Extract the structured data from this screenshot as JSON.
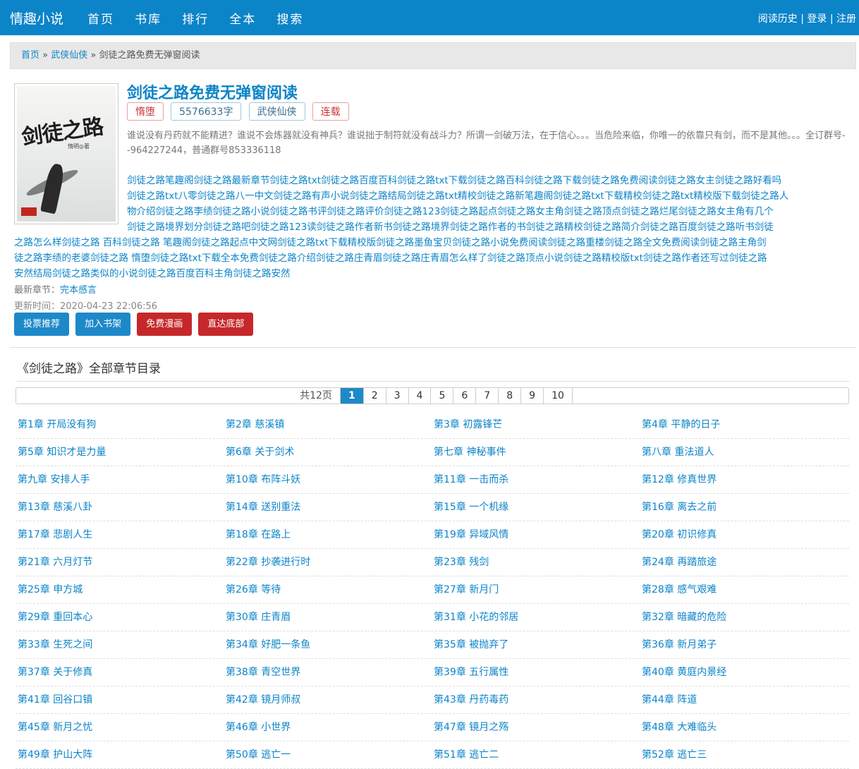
{
  "header": {
    "logo": "情趣小说",
    "nav": [
      "首页",
      "书库",
      "排行",
      "全本",
      "搜索"
    ],
    "history": "阅读历史",
    "login": "登录",
    "register": "注册",
    "sep": "|"
  },
  "breadcrumb": {
    "home": "首页",
    "category": "武侠仙侠",
    "current": "剑徒之路免费无弹窗阅读",
    "sep": "»"
  },
  "book": {
    "cover_title": "剑徒之路",
    "cover_author": "惰明◎著",
    "title": "剑徒之路免费无弹窗阅读",
    "author": "惰堕",
    "words": "5576633字",
    "category": "武侠仙侠",
    "status": "连载",
    "intro": "谁说没有丹药就不能精进？谁说不会炼器就没有神兵？谁说拙于制符就没有战斗力？所谓一剑破万法，在于信心。。。当危险来临，你唯一的依靠只有剑，而不是其他。。。全订群号--964227244，普通群号853336118",
    "keywords": [
      "剑徒之路笔趣阁剑徒之路最新章节剑徒之路txt剑徒之路百度百科剑徒之路txt下载剑徒之路百科剑徒之路下载剑徒之路免费阅读剑徒之路女主剑徒之路好看吗",
      "剑徒之路txt八零剑徒之路八一中文剑徒之路有声小说剑徒之路结局剑徒之路txt精校剑徒之路新笔趣阁剑徒之路txt下载精校剑徒之路txt精校版下载剑徒之路人",
      "物介绍剑徒之路李绩剑徒之路小说剑徒之路书评剑徒之路评价剑徒之路123剑徒之路起点剑徒之路女主角剑徒之路顶点剑徒之路烂尾剑徒之路女主角有几个",
      "剑徒之路境界划分剑徒之路吧剑徒之路123读剑徒之路作者新书剑徒之路境界剑徒之路作者的书剑徒之路精校剑徒之路简介剑徒之路百度剑徒之路听书剑徒",
      "之路怎么样剑徒之路 百科剑徒之路 笔趣阁剑徒之路起点中文网剑徒之路txt下载精校版剑徒之路墨鱼宝贝剑徒之路小说免费阅读剑徒之路重楼剑徒之路全文免费阅读剑徒之路主角剑",
      "徒之路李绩的老婆剑徒之路 惰堕剑徒之路txt下载全本免费剑徒之路介绍剑徒之路庄青眉剑徒之路庄青眉怎么样了剑徒之路顶点小说剑徒之路精校版txt剑徒之路作者还写过剑徒之路",
      "安然结局剑徒之路类似的小说剑徒之路百度百科主角剑徒之路安然"
    ],
    "latest_label": "最新章节：",
    "latest_chapter": "完本感言",
    "updated": "更新时间：2020-04-23 22:06:56"
  },
  "actions": [
    "投票推荐",
    "加入书架",
    "免费漫画",
    "直达底部"
  ],
  "catalog": {
    "title": "《剑徒之路》全部章节目录",
    "pager_total": "共12页",
    "pages": [
      "1",
      "2",
      "3",
      "4",
      "5",
      "6",
      "7",
      "8",
      "9",
      "10"
    ],
    "current_page": "1"
  },
  "chapters": [
    "第1章 开局没有狗",
    "第2章 慈溪镇",
    "第3章 初露锋芒",
    "第4章 平静的日子",
    "第5章 知识才是力量",
    "第6章 关于剑术",
    "第七章 神秘事件",
    "第八章 重法道人",
    "第九章 安排人手",
    "第10章 布阵斗妖",
    "第11章 一击而杀",
    "第12章 修真世界",
    "第13章 慈溪八卦",
    "第14章 送别重法",
    "第15章 一个机缘",
    "第16章 离去之前",
    "第17章 悲剧人生",
    "第18章 在路上",
    "第19章 异域风情",
    "第20章 初识修真",
    "第21章 六月灯节",
    "第22章 抄袭进行时",
    "第23章 残剑",
    "第24章 再踏旅途",
    "第25章 申方城",
    "第26章 等待",
    "第27章 新月门",
    "第28章 感气艰难",
    "第29章 重回本心",
    "第30章 庄青眉",
    "第31章 小花的邻居",
    "第32章 暗藏的危险",
    "第33章 生死之间",
    "第34章 好肥一条鱼",
    "第35章 被抛弃了",
    "第36章 新月弟子",
    "第37章 关于修真",
    "第38章 青空世界",
    "第39章 五行属性",
    "第40章 黄庭内景经",
    "第41章 回谷口镇",
    "第42章 镜月师叔",
    "第43章 丹药毒药",
    "第44章 阵道",
    "第45章 新月之忧",
    "第46章 小世界",
    "第47章 镜月之殇",
    "第48章 大难临头",
    "第49章 护山大阵",
    "第50章 逃亡一",
    "第51章 逃亡二",
    "第52章 逃亡三"
  ]
}
